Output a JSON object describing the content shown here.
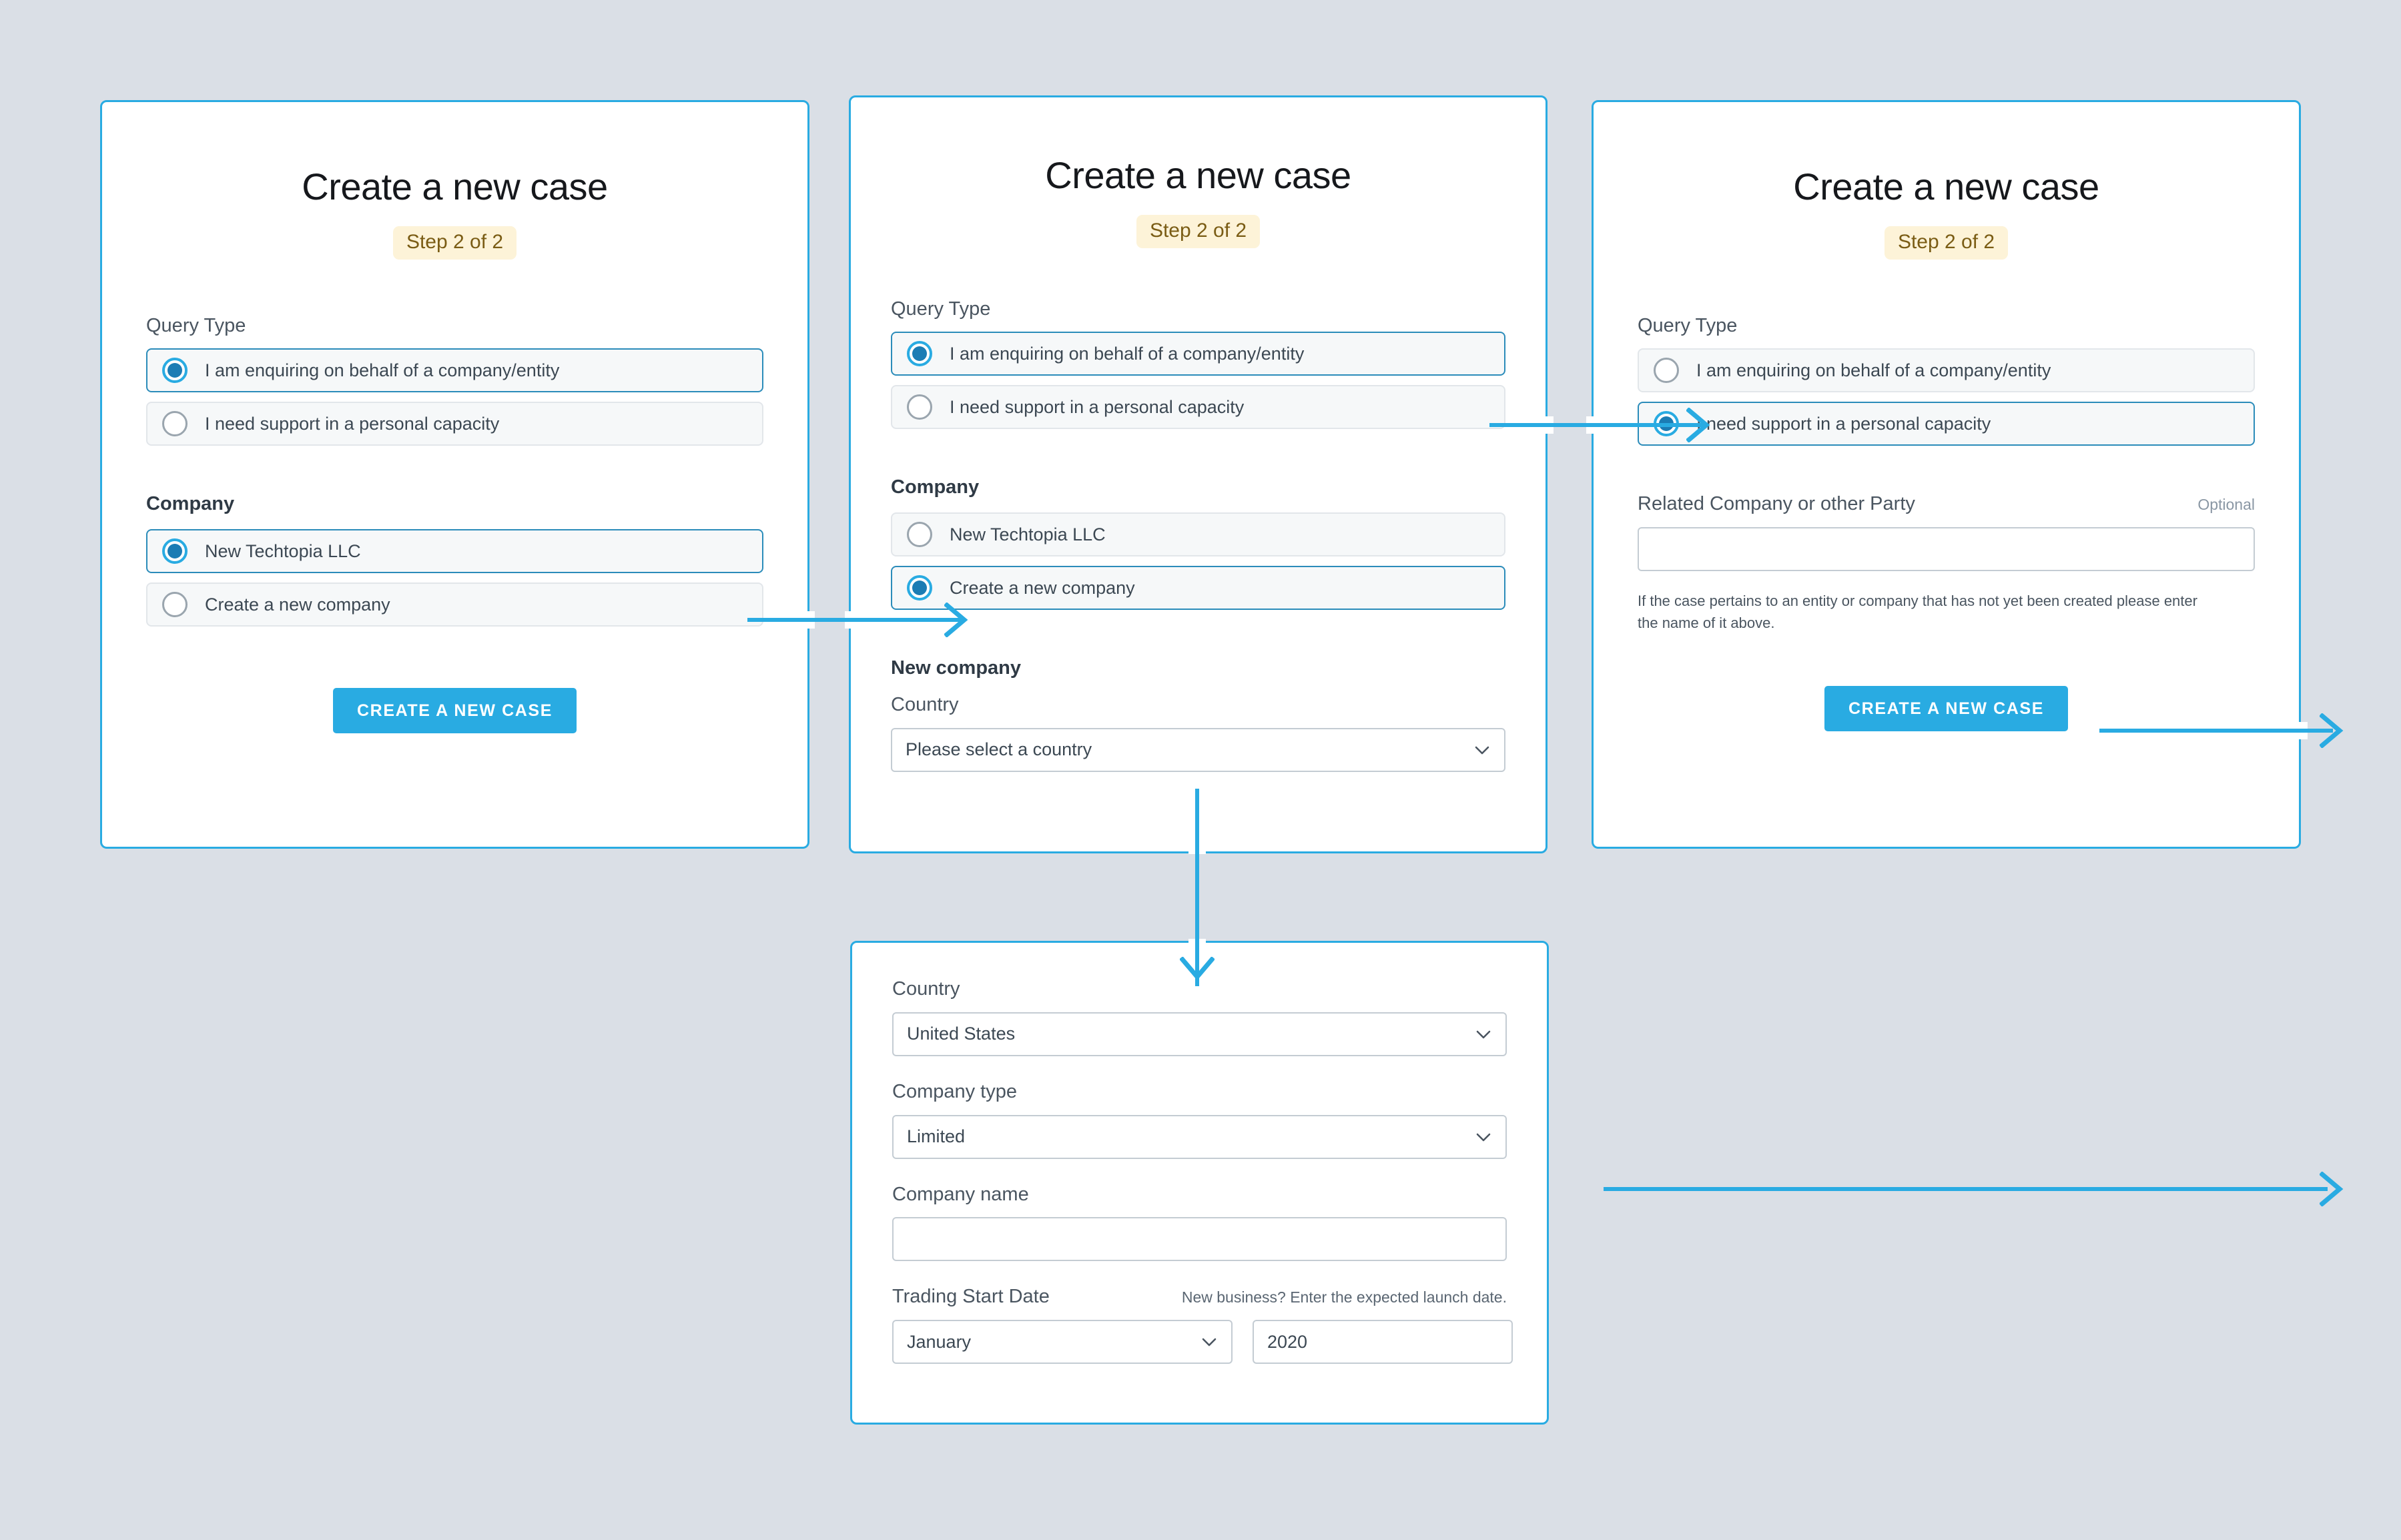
{
  "theme": {
    "background": "#dadfe6",
    "accent": "#29abe2",
    "card_border": "#29abe2",
    "radio_selected_fill": "#1b7cb4",
    "badge_bg": "#fdf3d8",
    "badge_text": "#7a5c14",
    "button_bg": "#29abe2",
    "input_border": "#c4ccd3"
  },
  "panel1": {
    "title": "Create a new case",
    "step_badge": "Step 2 of 2",
    "query_type_label": "Query Type",
    "query_options": [
      {
        "label": "I am enquiring on behalf of a company/entity",
        "selected": true
      },
      {
        "label": "I need support in a personal capacity",
        "selected": false
      }
    ],
    "company_label": "Company",
    "company_options": [
      {
        "label": "New Techtopia LLC",
        "selected": true
      },
      {
        "label": "Create a new company",
        "selected": false
      }
    ],
    "submit_label": "CREATE A NEW CASE"
  },
  "panel2": {
    "title": "Create a new case",
    "step_badge": "Step 2 of 2",
    "query_type_label": "Query Type",
    "query_options": [
      {
        "label": "I am enquiring on behalf of a company/entity",
        "selected": true
      },
      {
        "label": "I need support in a personal capacity",
        "selected": false
      }
    ],
    "company_label": "Company",
    "company_options": [
      {
        "label": "New Techtopia LLC",
        "selected": false
      },
      {
        "label": "Create a new company",
        "selected": true
      }
    ],
    "new_company_label": "New company",
    "country_label": "Country",
    "country_value": "Please select a country"
  },
  "panel3": {
    "title": "Create a new case",
    "step_badge": "Step 2 of 2",
    "query_type_label": "Query Type",
    "query_options": [
      {
        "label": "I am enquiring on behalf of a company/entity",
        "selected": false
      },
      {
        "label": "I need support in a personal capacity",
        "selected": true
      }
    ],
    "related_label": "Related Company or other Party",
    "related_optional": "Optional",
    "related_value": "",
    "related_help": "If the case pertains to an entity or company that has not yet been created please enter the name of it above.",
    "submit_label": "CREATE A NEW CASE"
  },
  "panel4": {
    "country_label": "Country",
    "country_value": "United States",
    "company_type_label": "Company type",
    "company_type_value": "Limited",
    "company_name_label": "Company name",
    "company_name_value": "",
    "trading_start_label": "Trading Start Date",
    "trading_start_hint": "New business? Enter the expected launch date.",
    "month_value": "January",
    "year_value": "2020"
  }
}
